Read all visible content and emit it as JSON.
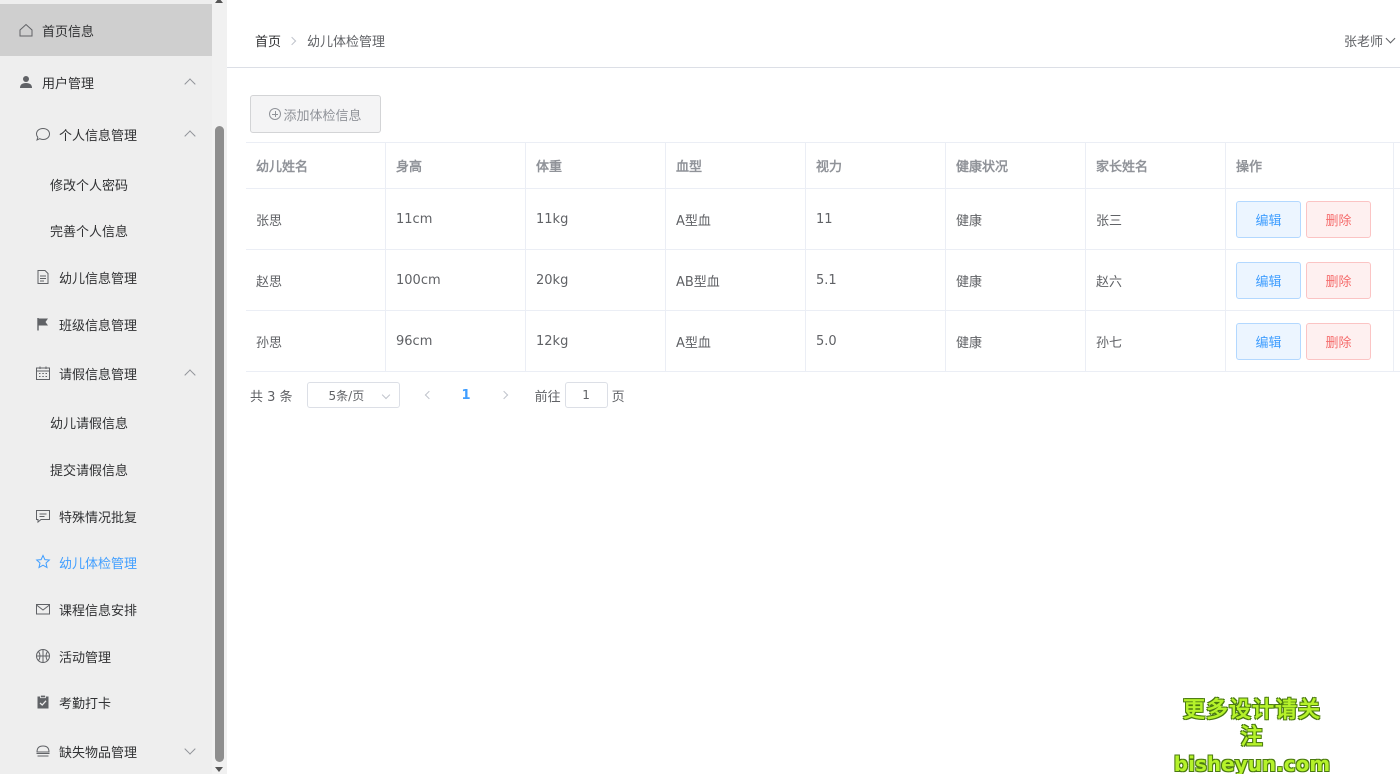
{
  "sidebar": {
    "items": [
      {
        "label": "首页信息",
        "icon": "home-icon"
      },
      {
        "label": "用户管理",
        "icon": "user-icon"
      },
      {
        "label": "个人信息管理",
        "icon": "chat-bubble-icon"
      },
      {
        "label": "修改个人密码"
      },
      {
        "label": "完善个人信息"
      },
      {
        "label": "幼儿信息管理",
        "icon": "document-icon"
      },
      {
        "label": "班级信息管理",
        "icon": "flag-icon"
      },
      {
        "label": "请假信息管理",
        "icon": "calendar-icon"
      },
      {
        "label": "幼儿请假信息"
      },
      {
        "label": "提交请假信息"
      },
      {
        "label": "特殊情况批复",
        "icon": "message-icon"
      },
      {
        "label": "幼儿体检管理",
        "icon": "star-icon"
      },
      {
        "label": "课程信息安排",
        "icon": "mail-icon"
      },
      {
        "label": "活动管理",
        "icon": "basketball-icon"
      },
      {
        "label": "考勤打卡",
        "icon": "clipboard-check-icon"
      },
      {
        "label": "缺失物品管理",
        "icon": "food-icon"
      }
    ]
  },
  "header": {
    "breadcrumb_home": "首页",
    "breadcrumb_current": "幼儿体检管理",
    "user": "张老师"
  },
  "toolbar": {
    "add_label": "添加体检信息"
  },
  "table": {
    "columns": [
      "幼儿姓名",
      "身高",
      "体重",
      "血型",
      "视力",
      "健康状况",
      "家长姓名",
      "操作"
    ],
    "rows": [
      [
        "张思",
        "11cm",
        "11kg",
        "A型血",
        "11",
        "健康",
        "张三"
      ],
      [
        "赵思",
        "100cm",
        "20kg",
        "AB型血",
        "5.1",
        "健康",
        "赵六"
      ],
      [
        "孙思",
        "96cm",
        "12kg",
        "A型血",
        "5.0",
        "健康",
        "孙七"
      ]
    ],
    "edit_label": "编辑",
    "delete_label": "删除"
  },
  "pagination": {
    "total": "共 3 条",
    "page_size": "5条/页",
    "current_page": "1",
    "goto_label": "前往",
    "goto_value": "1",
    "page_unit": "页"
  },
  "watermark": {
    "line1": "更多设计请关注",
    "line2": "bisheyun.com"
  },
  "colors": {
    "accent": "#409eff",
    "danger": "#f56c6c",
    "sidebar_bg": "#eeeeee",
    "watermark": "#b5f22a"
  }
}
